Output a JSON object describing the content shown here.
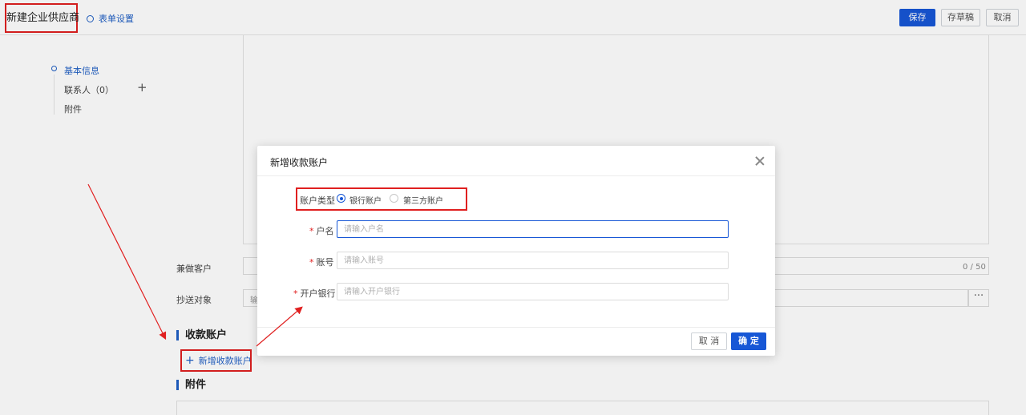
{
  "header": {
    "title": "新建企业供应商",
    "form_settings": "表单设置",
    "save": "保存",
    "draft": "存草稿",
    "cancel": "取消"
  },
  "left_nav": {
    "items": [
      {
        "label": "基本信息"
      },
      {
        "label": "联系人（0）"
      },
      {
        "label": "附件"
      }
    ]
  },
  "form": {
    "customer_label": "兼做客户",
    "counter": "0 / 50",
    "cc_label": "抄送对象",
    "cc_placeholder": "输",
    "dots": "···",
    "accounts_section": "收款账户",
    "add_account": "新增收款账户",
    "attachments_section": "附件"
  },
  "modal": {
    "title": "新增收款账户",
    "type_label": "账户类型",
    "type_options": [
      {
        "label": "银行账户",
        "checked": true
      },
      {
        "label": "第三方账户",
        "checked": false
      }
    ],
    "account_name": {
      "label": "户名",
      "placeholder": "请输入户名"
    },
    "account_no": {
      "label": "账号",
      "placeholder": "请输入账号"
    },
    "bank": {
      "label": "开户银行",
      "placeholder": "请输入开户银行"
    },
    "cancel": "取 消",
    "ok": "确 定"
  },
  "colors": {
    "primary": "#1757d6",
    "highlight": "#e02020"
  }
}
